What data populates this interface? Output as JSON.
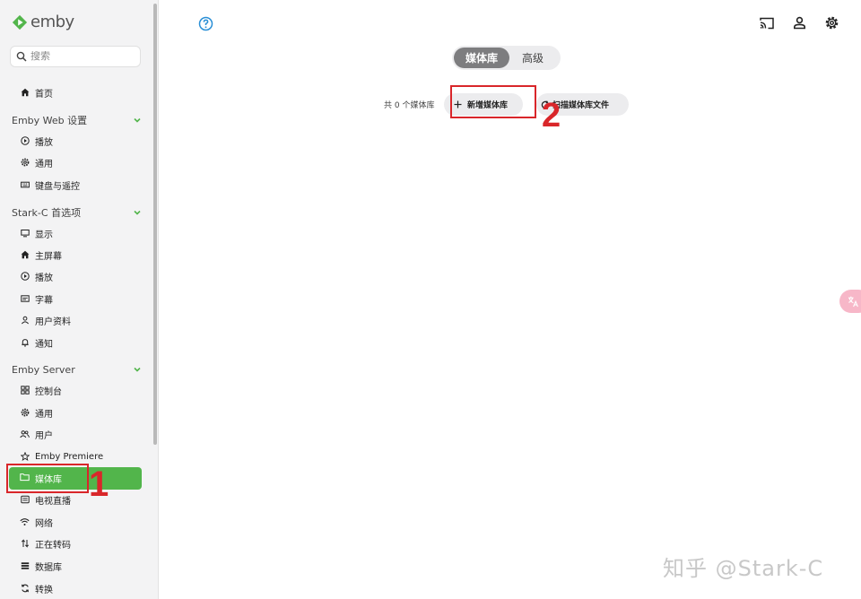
{
  "app": {
    "logo_text": "emby"
  },
  "search": {
    "placeholder": "搜索"
  },
  "sidebar": {
    "home": "首页",
    "sections": [
      {
        "title": "Emby Web 设置",
        "items": [
          "播放",
          "通用",
          "键盘与遥控"
        ]
      },
      {
        "title": "Stark-C 首选项",
        "items": [
          "显示",
          "主屏幕",
          "播放",
          "字幕",
          "用户资料",
          "通知"
        ]
      },
      {
        "title": "Emby Server",
        "items": [
          "控制台",
          "通用",
          "用户",
          "Emby Premiere",
          "媒体库",
          "电视直播",
          "网络",
          "正在转码",
          "数据库",
          "转换"
        ]
      }
    ],
    "active_item": "媒体库"
  },
  "main": {
    "tabs": [
      "媒体库",
      "高级"
    ],
    "active_tab": "媒体库",
    "library_count_text": "共 0 个媒体库",
    "add_library_label": "新增媒体库",
    "scan_label": "扫描媒体库文件"
  },
  "annotations": {
    "marker_1": "1",
    "marker_2": "2"
  },
  "watermark": "知乎 @Stark-C",
  "colors": {
    "accent_green": "#52b54b",
    "annotation_red": "#d9262a",
    "help_blue": "#2a8fd6"
  },
  "icons": {
    "header": [
      "cast-icon",
      "user-icon",
      "gear-icon"
    ],
    "help": "help-circle-icon"
  }
}
